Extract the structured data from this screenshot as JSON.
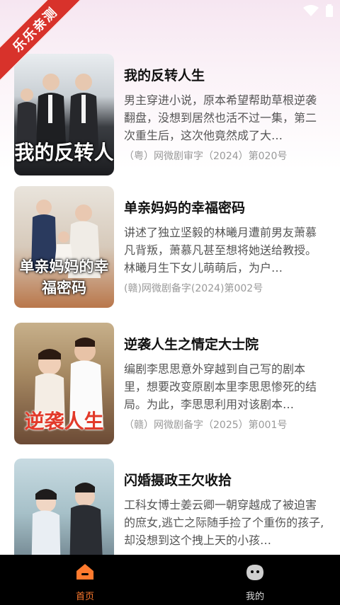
{
  "banner": {
    "text": "乐乐亲测"
  },
  "items": [
    {
      "title": "我的反转人生",
      "poster_text": "我的反转人",
      "desc": "男主穿进小说，原本希望帮助草根逆袭翻盘，没想到居然也活不过一集，第二次重生后，这次他竟然成了大…",
      "meta": "（粤）网微剧审字（2024）第020号"
    },
    {
      "title": "单亲妈妈的幸福密码",
      "poster_text": "单亲妈妈的幸福密码",
      "desc": "讲述了独立坚毅的林曦月遭前男友萧慕凡背叛，萧慕凡甚至想将她送给教授。林曦月生下女儿萌萌后，为户…",
      "meta": "(赣)网微剧备字(2024)第002号"
    },
    {
      "title": "逆袭人生之情定大士院",
      "poster_text": "逆袭人生",
      "desc": "编剧李思思意外穿越到自己写的剧本里，想要改变原剧本里李思思惨死的结局。为此，李思思利用对该剧本…",
      "meta": "（赣）网微剧备字（2025）第001号"
    },
    {
      "title": "闪婚摄政王欠收拾",
      "poster_text": "",
      "desc": "工科女博士姜云卿一朝穿越成了被迫害的庶女,逃亡之际随手捡了个重伤的孩子,却没想到这个拽上天的小孩…",
      "meta": ""
    }
  ],
  "nav": {
    "home_label": "首页",
    "mine_label": "我的"
  },
  "colors": {
    "accent": "#ff7a2e",
    "banner": "#d8322b"
  }
}
